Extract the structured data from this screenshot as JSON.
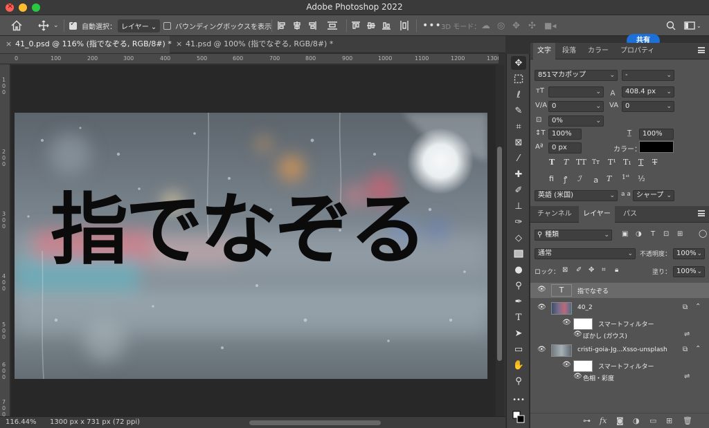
{
  "app": {
    "title": "Adobe Photoshop 2022"
  },
  "options_bar": {
    "auto_select_label": "自動選択：",
    "auto_select_target": "レイヤー",
    "show_bounding_box_label": "バウンディングボックスを表示",
    "mode_3d_label": "3D モード：",
    "share_label": "共有"
  },
  "tabs": [
    {
      "label": "41_0.psd @ 116% (指でなぞる, RGB/8#) *"
    },
    {
      "label": "41.psd @ 100% (指でなぞる, RGB/8#) *"
    }
  ],
  "rulers": {
    "top": [
      "0",
      "100",
      "200",
      "300",
      "400",
      "500",
      "600",
      "700",
      "800",
      "900",
      "1000",
      "1100",
      "1200",
      "1300"
    ],
    "left": [
      "100",
      "200",
      "300",
      "400",
      "500",
      "600",
      "700"
    ]
  },
  "canvas": {
    "text": "指でなぞる"
  },
  "status": {
    "zoom": "116.44%",
    "doc_info": "1300 px x 731 px (72 ppi)"
  },
  "character_panel": {
    "tabs": [
      "文字",
      "段落",
      "カラー",
      "プロパティ"
    ],
    "font_family": "851マカポップ",
    "font_style": "-",
    "font_size": "",
    "leading": "408.4 px",
    "kerning": "0",
    "tracking": "0",
    "tsume": "0%",
    "vertical_scale": "100%",
    "horizontal_scale": "100%",
    "baseline_shift": "0 px",
    "color_label": "カラー：",
    "color": "#000000",
    "language": "英語 (米国)",
    "aa_label": "a a",
    "antialias": "シャープ"
  },
  "layers_panel": {
    "tabs": [
      "チャンネル",
      "レイヤー",
      "パス"
    ],
    "filter_kind": "種類",
    "blend_mode": "通常",
    "opacity_label": "不透明度：",
    "opacity": "100%",
    "lock_label": "ロック：",
    "fill_label": "塗り：",
    "fill": "100%",
    "layers": [
      {
        "name": "指でなぞる",
        "type": "text"
      },
      {
        "name": "40_2",
        "type": "smart"
      },
      {
        "name": "スマートフィルター",
        "type": "filter-header"
      },
      {
        "name": "ぼかし (ガウス)",
        "type": "filter"
      },
      {
        "name": "cristi-goia-Jg...Xsso-unsplash",
        "type": "smart"
      },
      {
        "name": "スマートフィルター",
        "type": "filter-header"
      },
      {
        "name": "色相・彩度",
        "type": "filter"
      }
    ]
  }
}
